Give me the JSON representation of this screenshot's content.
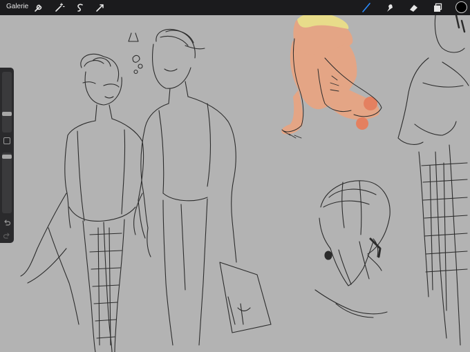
{
  "topbar": {
    "gallery_label": "Galerie",
    "left_tools": [
      {
        "name": "wrench-icon",
        "label": "actions"
      },
      {
        "name": "magic-wand-icon",
        "label": "adjustments"
      },
      {
        "name": "selection-icon",
        "label": "selection"
      },
      {
        "name": "transform-icon",
        "label": "transform"
      }
    ],
    "right_tools": [
      {
        "name": "brush-icon",
        "label": "paint",
        "active": true
      },
      {
        "name": "smudge-icon",
        "label": "smudge"
      },
      {
        "name": "eraser-icon",
        "label": "eraser"
      },
      {
        "name": "layers-icon",
        "label": "layers"
      }
    ],
    "active_tool_color": "#2a8cff",
    "current_color": "#000000"
  },
  "sidebar": {
    "brush_size_level": 0.31,
    "opacity_level": 0.07
  },
  "canvas": {
    "background": "#b3b3b3",
    "stroke_color": "#2b2b2b",
    "skin_color": "#e4a585",
    "hair_color": "#e8dc8a"
  }
}
